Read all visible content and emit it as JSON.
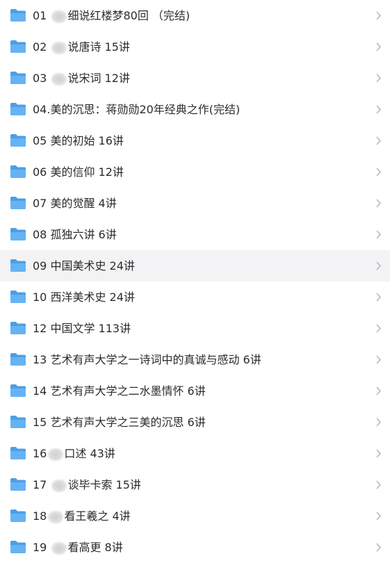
{
  "rows": [
    {
      "pre": "01 ",
      "blur": true,
      "post": "细说红楼梦80回 （完结)",
      "active": false
    },
    {
      "pre": "02 ",
      "blur": true,
      "post": "说唐诗 15讲",
      "active": false
    },
    {
      "pre": "03 ",
      "blur": true,
      "post": "说宋词 12讲",
      "active": false
    },
    {
      "pre": "04.美的沉思：蒋勋勋20年经典之作(完结)",
      "blur": false,
      "post": "",
      "active": false
    },
    {
      "pre": "05 美的初始 16讲",
      "blur": false,
      "post": "",
      "active": false
    },
    {
      "pre": "06 美的信仰 12讲",
      "blur": false,
      "post": "",
      "active": false
    },
    {
      "pre": "07 美的觉醒 4讲",
      "blur": false,
      "post": "",
      "active": false
    },
    {
      "pre": "08 孤独六讲 6讲",
      "blur": false,
      "post": "",
      "active": false
    },
    {
      "pre": "09 中国美术史 24讲",
      "blur": false,
      "post": "",
      "active": true
    },
    {
      "pre": "10 西洋美术史 24讲",
      "blur": false,
      "post": "",
      "active": false
    },
    {
      "pre": "12 中国文学 113讲",
      "blur": false,
      "post": "",
      "active": false
    },
    {
      "pre": "13 艺术有声大学之一诗词中的真诚与感动 6讲",
      "blur": false,
      "post": "",
      "active": false
    },
    {
      "pre": "14 艺术有声大学之二水墨情怀 6讲",
      "blur": false,
      "post": "",
      "active": false
    },
    {
      "pre": "15 艺术有声大学之三美的沉思 6讲",
      "blur": false,
      "post": "",
      "active": false
    },
    {
      "pre": "16",
      "blur": true,
      "post": "口述 43讲",
      "active": false
    },
    {
      "pre": "17 ",
      "blur": true,
      "post": "谈毕卡索 15讲",
      "active": false
    },
    {
      "pre": "18",
      "blur": true,
      "post": "看王羲之 4讲",
      "active": false
    },
    {
      "pre": "19 ",
      "blur": true,
      "post": "看高更 8讲",
      "active": false
    }
  ],
  "icons": {
    "folder": "folder-icon",
    "chevron": "chevron-right-icon"
  },
  "colors": {
    "folder_back": "#4a9fe8",
    "folder_front": "#66b3f4",
    "text": "#2b2b2b",
    "chevron": "#b3b3b3",
    "active_bg": "#f3f3f5"
  }
}
